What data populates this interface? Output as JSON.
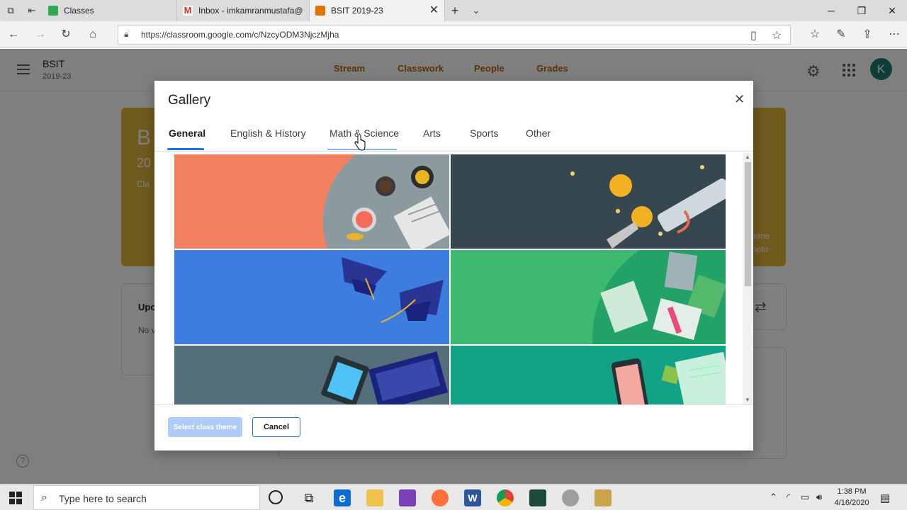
{
  "browser": {
    "tabs": [
      {
        "label": "Classes",
        "icon": "classroom-favicon",
        "color": "#34a853"
      },
      {
        "label": "Inbox - imkamranmustafa@",
        "icon": "gmail-favicon",
        "color": "#d93025"
      },
      {
        "label": "BSIT 2019-23",
        "icon": "classroom-favicon",
        "color": "#e37400"
      }
    ],
    "url": "https://classroom.google.com/c/NzcyODM3NjczMjha"
  },
  "classroom": {
    "class_name": "BSIT",
    "class_section": "2019-23",
    "nav_tabs": [
      "Stream",
      "Classwork",
      "People",
      "Grades"
    ],
    "avatar_initial": "K",
    "accent_color": "#b06a00"
  },
  "background": {
    "banner_partial_1": "B",
    "banner_partial_2": "20",
    "banner_partial_3": "Cla",
    "banner_right_1": "eme",
    "banner_right_2": "hoto",
    "card_title_partial": "Upc",
    "card_text_partial": "No v"
  },
  "dialog": {
    "title": "Gallery",
    "tabs": [
      "General",
      "English & History",
      "Math & Science",
      "Arts",
      "Sports",
      "Other"
    ],
    "active_tab": "General",
    "hovered_tab": "Math & Science",
    "themes": [
      {
        "name": "coffee-and-newspaper-theme",
        "color": "#f08060"
      },
      {
        "name": "diploma-and-medals-theme",
        "color": "#37474f"
      },
      {
        "name": "graduation-caps-theme",
        "color": "#3d7de0"
      },
      {
        "name": "books-on-green-theme",
        "color": "#3dba6f"
      },
      {
        "name": "laptop-and-tablet-theme",
        "color": "#546e7a"
      },
      {
        "name": "phone-and-documents-theme",
        "color": "#12a386"
      }
    ],
    "select_button": "Select class theme",
    "cancel_button": "Cancel"
  },
  "taskbar": {
    "search_placeholder": "Type here to search",
    "time": "1:38 PM",
    "date": "4/16/2020"
  }
}
